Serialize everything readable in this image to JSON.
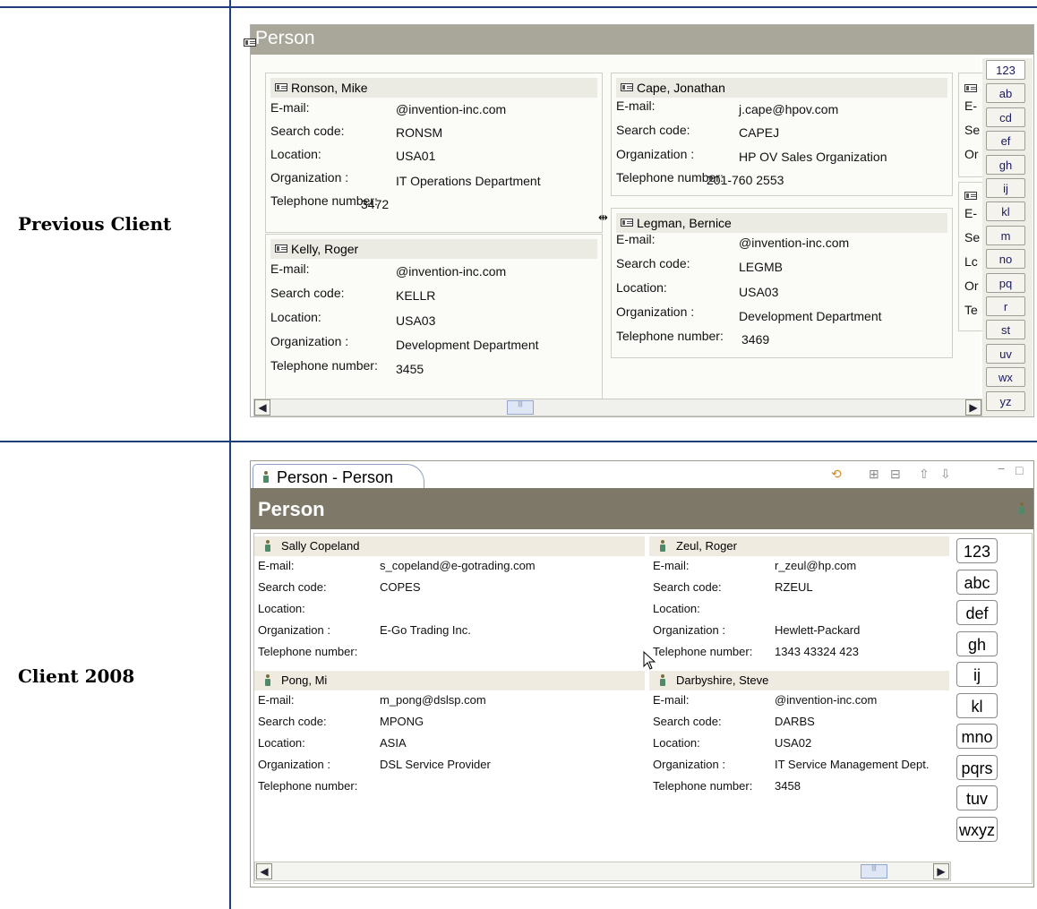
{
  "rows": {
    "previous_label": "Previous Client",
    "new_label": "Client 2008"
  },
  "previous": {
    "title": "Person",
    "header_icon": "card-icon",
    "cards": [
      {
        "name": "Ronson, Mike",
        "fields": [
          {
            "label": "E-mail:",
            "value": "@invention-inc.com"
          },
          {
            "label": "Search code:",
            "value": "RONSM"
          },
          {
            "label": "Location:",
            "value": "USA01"
          },
          {
            "label": "Organization  :",
            "value": "IT Operations Department"
          },
          {
            "label": "Telephone number:",
            "value": "3472"
          }
        ]
      },
      {
        "name": "Kelly, Roger",
        "fields": [
          {
            "label": "E-mail:",
            "value": "@invention-inc.com"
          },
          {
            "label": "Search code:",
            "value": "KELLR"
          },
          {
            "label": "Location:",
            "value": "USA03"
          },
          {
            "label": "Organization  :",
            "value": "Development Department"
          },
          {
            "label": "Telephone number:",
            "value": "3455"
          }
        ]
      },
      {
        "name": "Cape, Jonathan",
        "fields": [
          {
            "label": "E-mail:",
            "value": "j.cape@hpov.com"
          },
          {
            "label": "Search code:",
            "value": "CAPEJ"
          },
          {
            "label": "Organization  :",
            "value": "HP OV Sales Organization"
          },
          {
            "label": "Telephone number:",
            "value": "201-760 2553"
          }
        ]
      },
      {
        "name": "Legman, Bernice",
        "fields": [
          {
            "label": "E-mail:",
            "value": "@invention-inc.com"
          },
          {
            "label": "Search code:",
            "value": "LEGMB"
          },
          {
            "label": "Location:",
            "value": "USA03"
          },
          {
            "label": "Organization  :",
            "value": "Development Department"
          },
          {
            "label": "Telephone number:",
            "value": "3469"
          }
        ]
      }
    ],
    "partial_labels_top": [
      "E-",
      "Se",
      "Or"
    ],
    "partial_labels_bottom": [
      "E-",
      "Se",
      "Lc",
      "Or",
      "Te"
    ],
    "index": [
      "123",
      "ab",
      "cd",
      "ef",
      "gh",
      "ij",
      "kl",
      "m",
      "no",
      "pq",
      "r",
      "st",
      "uv",
      "wx",
      "yz"
    ]
  },
  "client2008": {
    "tab_label": "Person - Person",
    "title": "Person",
    "toolbar_icons": [
      "sync-icon",
      "expand-all-icon",
      "collapse-all-icon",
      "arrow-up-icon",
      "arrow-down-icon",
      "minimize-icon",
      "maximize-icon"
    ],
    "cards": [
      {
        "name": "Sally Copeland",
        "fields": [
          {
            "label": "E-mail:",
            "value": "s_copeland@e-gotrading.com"
          },
          {
            "label": "Search code:",
            "value": "COPES"
          },
          {
            "label": "Location:",
            "value": ""
          },
          {
            "label": "Organization :",
            "value": "E-Go Trading Inc."
          },
          {
            "label": "Telephone number:",
            "value": ""
          }
        ]
      },
      {
        "name": "Pong, Mi",
        "fields": [
          {
            "label": "E-mail:",
            "value": "m_pong@dslsp.com"
          },
          {
            "label": "Search code:",
            "value": "MPONG"
          },
          {
            "label": "Location:",
            "value": "ASIA"
          },
          {
            "label": "Organization :",
            "value": "DSL Service Provider"
          },
          {
            "label": "Telephone number:",
            "value": ""
          }
        ]
      },
      {
        "name": "Zeul, Roger",
        "fields": [
          {
            "label": "E-mail:",
            "value": "r_zeul@hp.com"
          },
          {
            "label": "Search code:",
            "value": "RZEUL"
          },
          {
            "label": "Location:",
            "value": ""
          },
          {
            "label": "Organization :",
            "value": "Hewlett-Packard"
          },
          {
            "label": "Telephone number:",
            "value": "1343 43324 423"
          }
        ]
      },
      {
        "name": "Darbyshire, Steve",
        "fields": [
          {
            "label": "E-mail:",
            "value": "@invention-inc.com"
          },
          {
            "label": "Search code:",
            "value": "DARBS"
          },
          {
            "label": "Location:",
            "value": "USA02"
          },
          {
            "label": "Organization :",
            "value": "IT Service Management Dept."
          },
          {
            "label": "Telephone number:",
            "value": "3458"
          }
        ]
      }
    ],
    "index": [
      "123",
      "abc",
      "def",
      "gh",
      "ij",
      "kl",
      "mno",
      "pqrs",
      "tuv",
      "wxyz"
    ]
  }
}
